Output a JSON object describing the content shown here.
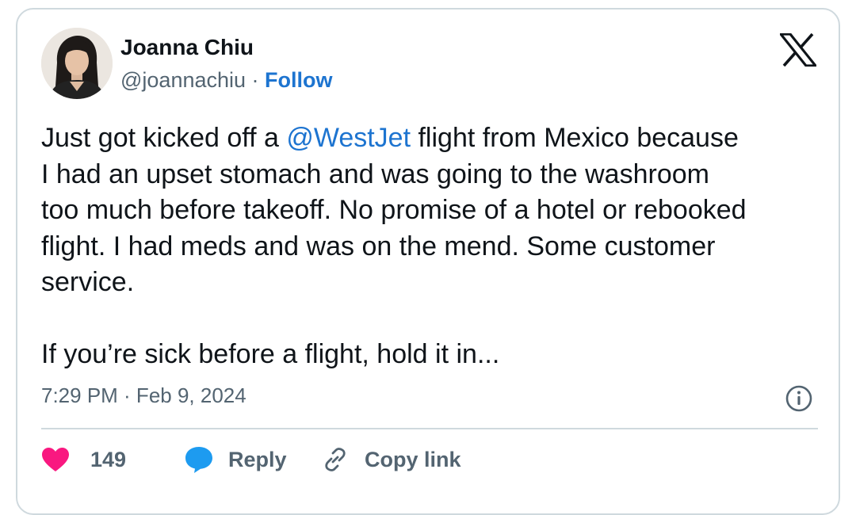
{
  "author": {
    "name": "Joanna Chiu",
    "handle": "@joannachiu",
    "separator": " · ",
    "follow_label": "Follow"
  },
  "tweet": {
    "lines": [
      {
        "before": "Just got kicked off a ",
        "mention": "@WestJet",
        "after": " flight from Mexico because"
      },
      "I had an upset stomach and was going to the washroom",
      "too much before takeoff. No promise of a hotel or rebooked",
      "flight. I had meds and was on the mend. Some customer",
      "service.",
      "",
      "If you’re sick before a flight, hold it in..."
    ],
    "timestamp": "7:29 PM · Feb 9, 2024"
  },
  "actions": {
    "like_count": "149",
    "reply_label": "Reply",
    "copy_link_label": "Copy link"
  },
  "colors": {
    "link": "#1d74d0",
    "like": "#f91880",
    "reply": "#1d9bf0",
    "text": "#0f1419",
    "muted": "#536471",
    "border": "#cfd9de"
  },
  "icons": [
    "x-logo-icon",
    "info-icon",
    "heart-icon",
    "reply-bubble-icon",
    "link-icon"
  ]
}
